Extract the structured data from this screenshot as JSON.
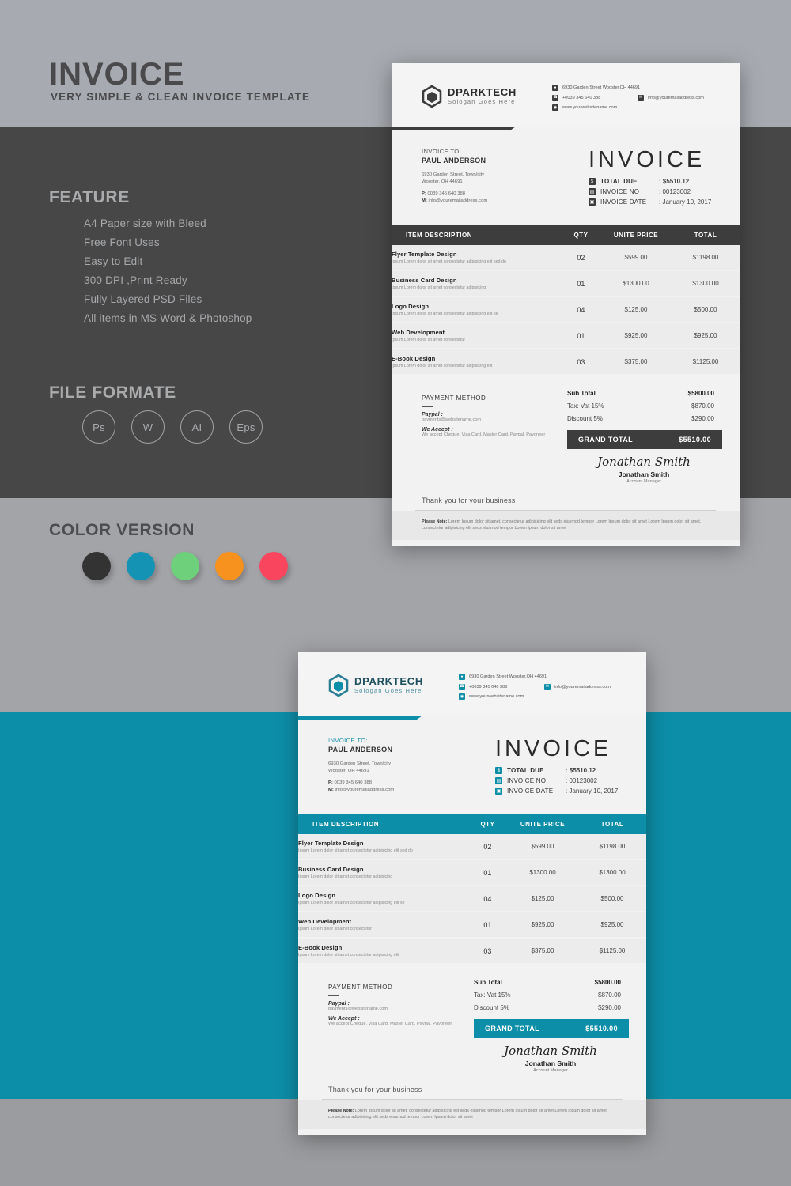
{
  "promo": {
    "title": "INVOICE",
    "subtitle": "VERY SIMPLE & CLEAN INVOICE TEMPLATE",
    "feature_heading": "FEATURE",
    "features": [
      "A4 Paper size with Bleed",
      "Free Font Uses",
      "Easy to Edit",
      "300 DPI ,Print Ready",
      "Fully Layered PSD Files",
      "All items in MS Word & Photoshop"
    ],
    "format_heading": "FILE FORMATE",
    "formats": [
      "Ps",
      "W",
      "AI",
      "Eps"
    ],
    "color_heading": "COLOR VERSION",
    "colors": [
      "#333333",
      "#1593b5",
      "#6ed07a",
      "#f7921e",
      "#f9455e"
    ]
  },
  "theme": {
    "dark_accent": "#3d3d3d",
    "teal_accent": "#0d8ea8"
  },
  "invoice": {
    "brand": {
      "name": "DPARKTECH",
      "slogan": "Sologan Goes Here"
    },
    "contact": {
      "address": "6930 Garden Street Wooster,OH 44691",
      "phone": "+0039 345 640 388",
      "email": "info@youremailaddress.com",
      "website": "www.yourwebsitename.com"
    },
    "bill_to": {
      "label": "INVOICE TO:",
      "name": "PAUL ANDERSON",
      "address_line1": "6930 Garden Street, Town/city",
      "address_line2": "Wooster, OH 44691",
      "phone_label": "P:",
      "phone": "0039 345 640 388",
      "email_label": "M:",
      "email": "info@youremailaddress.com"
    },
    "title": "INVOICE",
    "meta": [
      {
        "key": "TOTAL DUE",
        "value": ": $5510.12",
        "icon": "dollar-icon"
      },
      {
        "key": "INVOICE NO",
        "value": ": 00123002",
        "icon": "list-icon"
      },
      {
        "key": "INVOICE DATE",
        "value": ": January 10, 2017",
        "icon": "calendar-icon"
      }
    ],
    "table": {
      "headers": [
        "ITEM DESCRIPTION",
        "QTY",
        "UNITE PRICE",
        "TOTAL"
      ],
      "rows": [
        {
          "title": "Flyer Template Design",
          "sub": "Ipsum Lorem dolor sit amet consectetur adipisicing elit sed do",
          "qty": "02",
          "price": "$599.00",
          "total": "$1198.00"
        },
        {
          "title": "Business Card Design",
          "sub": "Ipsum Lorem dolor sit amet consectetur adipisicing",
          "qty": "01",
          "price": "$1300.00",
          "total": "$1300.00"
        },
        {
          "title": "Logo Design",
          "sub": "Ipsum Lorem dolor sit amet consectetur adipisicing elit se",
          "qty": "04",
          "price": "$125.00",
          "total": "$500.00"
        },
        {
          "title": "Web Development",
          "sub": "Ipsum Lorem dolor sit amet consectetur",
          "qty": "01",
          "price": "$925.00",
          "total": "$925.00"
        },
        {
          "title": "E-Book Design",
          "sub": "Ipsum Lorem dolor sit amet consectetur adipisicing elit",
          "qty": "03",
          "price": "$375.00",
          "total": "$1125.00"
        }
      ]
    },
    "totals": [
      {
        "label": "Sub Total",
        "value": "$5800.00",
        "bold": true
      },
      {
        "label": "Tax: Vat 15%",
        "value": "$870.00",
        "bold": false
      },
      {
        "label": "Discount 5%",
        "value": "$290.00",
        "bold": false
      }
    ],
    "grand_total": {
      "label": "GRAND TOTAL",
      "value": "$5510.00"
    },
    "payment": {
      "heading": "PAYMENT METHOD",
      "paypal_label": "Paypal :",
      "paypal_value": "payments@websitename.com",
      "accept_label": "We Accept :",
      "accept_value": "We accept Cheque, Visa Card, Master Card, Paypal, Payoneer"
    },
    "signature": {
      "script": "Jonathan Smith",
      "name": "Jonathan Smith",
      "role": "Account Manager"
    },
    "thanks": "Thank you for your business",
    "note": {
      "label": "Please Note:",
      "text": " Lorem Ipsum dolor sit amet, consectetur adipisicing elit seds eiusmod tempor Lorem Ipsum dolor sit amet Lorem Ipsum dolor sit amet, consectetur adipisicing elit seds eiusmod tempor Lorem Ipsum dolor sit amet"
    }
  }
}
